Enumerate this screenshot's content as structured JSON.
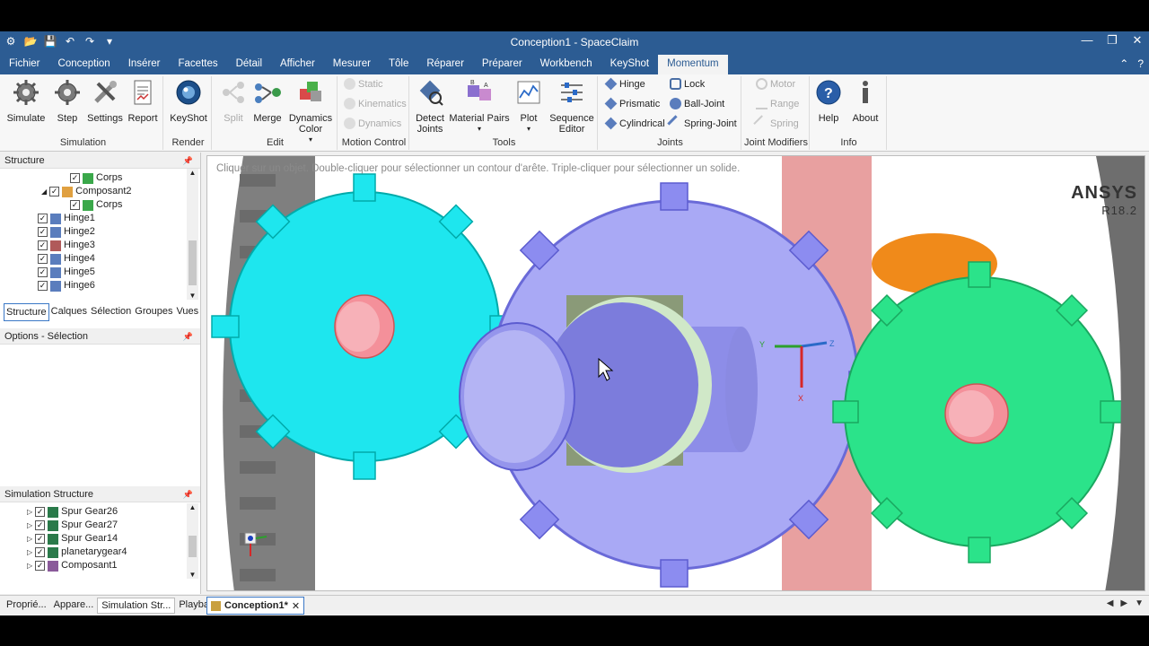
{
  "window": {
    "title": "Conception1 - SpaceClaim",
    "controls": [
      "—",
      "❐",
      "✕"
    ]
  },
  "menu": {
    "tabs": [
      "Fichier",
      "Conception",
      "Insérer",
      "Facettes",
      "Détail",
      "Afficher",
      "Mesurer",
      "Tôle",
      "Réparer",
      "Préparer",
      "Workbench",
      "KeyShot",
      "Momentum"
    ],
    "active": "Momentum"
  },
  "ribbon": {
    "simulation": {
      "label": "Simulation",
      "simulate": "Simulate",
      "step": "Step",
      "settings": "Settings",
      "report": "Report"
    },
    "render": {
      "label": "Render",
      "keyshot": "KeyShot"
    },
    "edit": {
      "label": "Edit",
      "split": "Split",
      "merge": "Merge",
      "dynamics_color": "Dynamics Color"
    },
    "motion_control": {
      "label": "Motion Control",
      "static": "Static",
      "kinematics": "Kinematics",
      "dynamics": "Dynamics"
    },
    "tools": {
      "label": "Tools",
      "detect_joints": "Detect Joints",
      "material_pairs": "Material Pairs",
      "plot": "Plot",
      "sequence_editor": "Sequence Editor"
    },
    "joints": {
      "label": "Joints",
      "hinge": "Hinge",
      "lock": "Lock",
      "prismatic": "Prismatic",
      "ball_joint": "Ball-Joint",
      "cylindrical": "Cylindrical",
      "spring_joint": "Spring-Joint"
    },
    "joint_modifiers": {
      "label": "Joint Modifiers",
      "motor": "Motor",
      "range": "Range",
      "spring": "Spring"
    },
    "info": {
      "label": "Info",
      "help": "Help",
      "about": "About"
    }
  },
  "structure_panel": {
    "title": "Structure",
    "items": [
      {
        "label": "Corps",
        "indent": 2
      },
      {
        "label": "Composant2",
        "indent": 1
      },
      {
        "label": "Corps",
        "indent": 2
      },
      {
        "label": "Hinge1",
        "indent": 0
      },
      {
        "label": "Hinge2",
        "indent": 0
      },
      {
        "label": "Hinge3",
        "indent": 0
      },
      {
        "label": "Hinge4",
        "indent": 0
      },
      {
        "label": "Hinge5",
        "indent": 0
      },
      {
        "label": "Hinge6",
        "indent": 0
      }
    ],
    "tabs": [
      "Structure",
      "Calques",
      "Sélection",
      "Groupes",
      "Vues"
    ]
  },
  "options_panel": {
    "title": "Options - Sélection"
  },
  "simulation_structure": {
    "title": "Simulation Structure",
    "items": [
      "Spur Gear26",
      "Spur Gear27",
      "Spur Gear14",
      "planetarygear4",
      "Composant1"
    ]
  },
  "viewport": {
    "hint": "Cliquer sur un objet. Double-cliquer pour sélectionner un contour d'arête. Triple-cliquer pour sélectionner un solide.",
    "brand": "ANSYS",
    "version": "R18.2",
    "axes": {
      "x": "X",
      "y": "Y",
      "z": "Z"
    }
  },
  "bottom": {
    "tabs": [
      "Proprié...",
      "Appare...",
      "Simulation Str...",
      "Playback"
    ],
    "active": "Simulation Str...",
    "doc_tab": "Conception1*"
  },
  "colors": {
    "titlebar": "#2c5c93",
    "gear_cyan": "#1ee6ee",
    "gear_lavender": "#a9a9f5",
    "gear_green": "#2be38a",
    "gear_gray": "#8a8a8a"
  }
}
